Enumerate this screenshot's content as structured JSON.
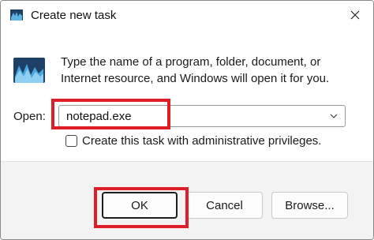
{
  "window": {
    "title": "Create new task",
    "close_icon": "close-icon",
    "app_icon": "run-dialog-icon"
  },
  "body": {
    "description": "Type the name of a program, folder, document, or Internet resource, and Windows will open it for you.",
    "open_label": "Open:",
    "open_value": "notepad.exe",
    "dropdown_icon": "chevron-down-icon",
    "admin_checkbox_label": "Create this task with administrative privileges.",
    "admin_checked": false
  },
  "buttons": {
    "ok": "OK",
    "cancel": "Cancel",
    "browse": "Browse..."
  },
  "colors": {
    "highlight": "#e01e27",
    "footer_bg": "#f3f3f3",
    "icon_blue": "#1e3f66"
  }
}
